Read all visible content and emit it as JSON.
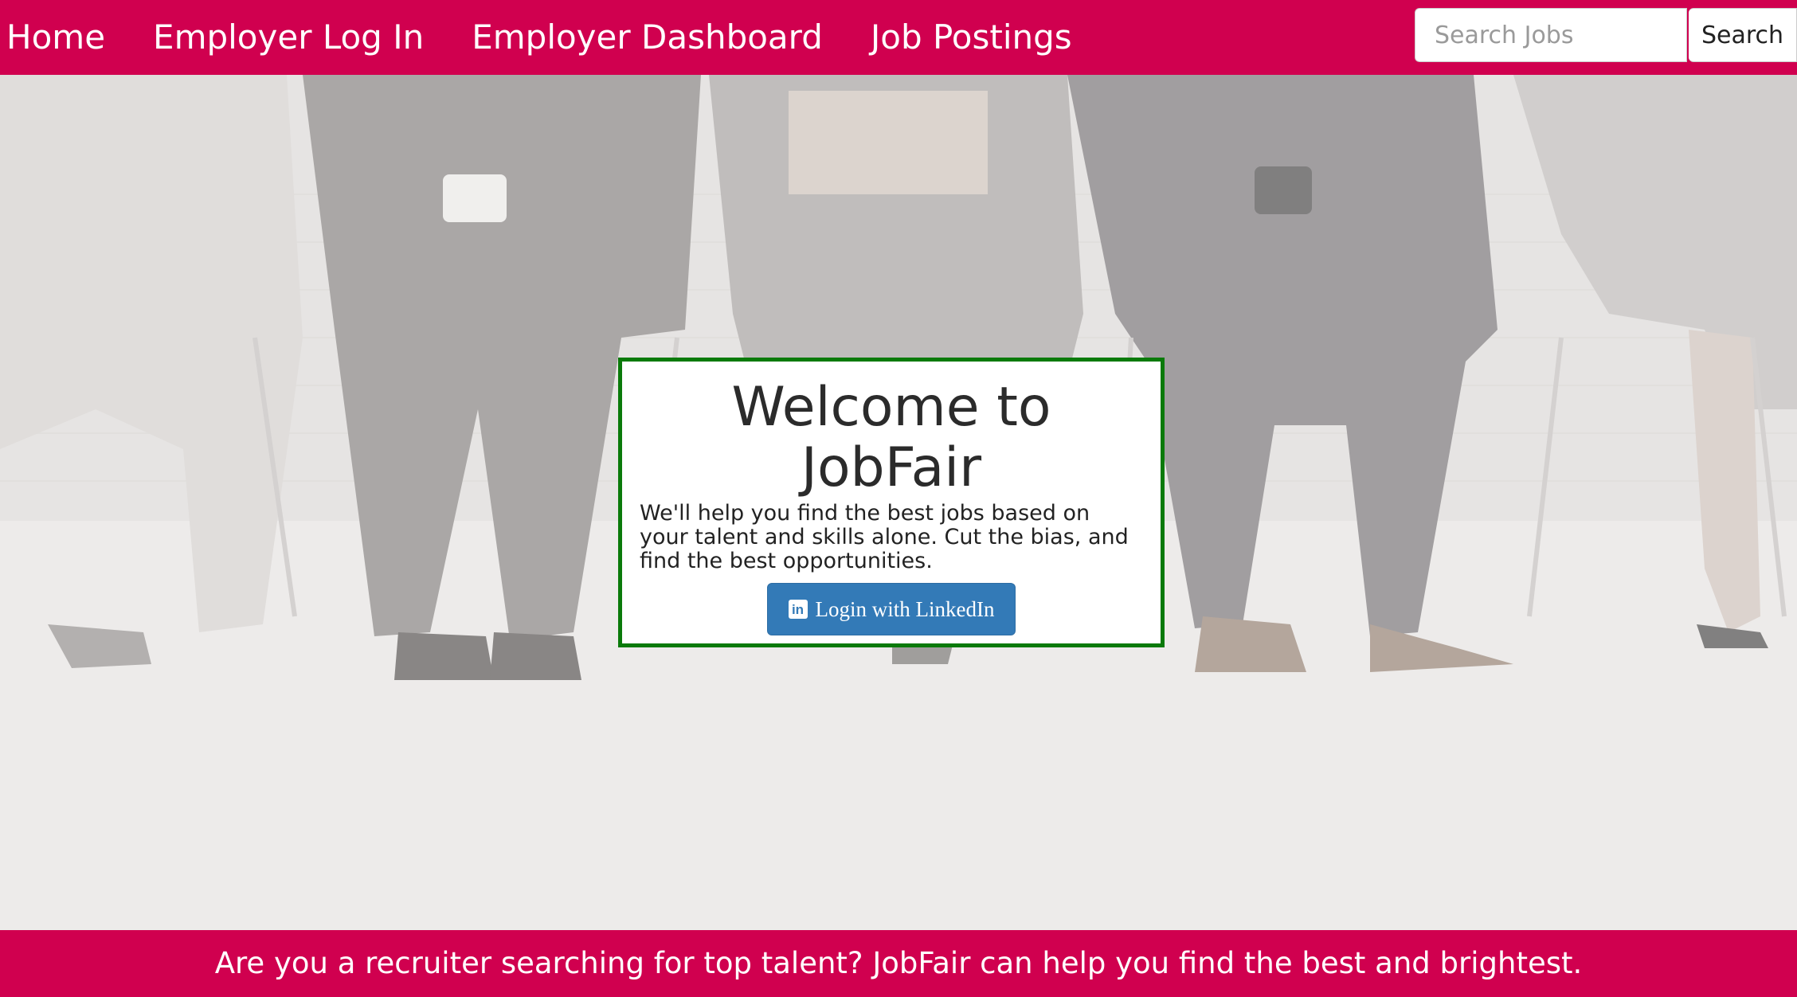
{
  "nav": {
    "items": [
      {
        "label": "Home"
      },
      {
        "label": "Employer Log In"
      },
      {
        "label": "Employer Dashboard"
      },
      {
        "label": "Job Postings"
      }
    ]
  },
  "search": {
    "placeholder": "Search Jobs",
    "value": "",
    "button_label": "Search"
  },
  "welcome": {
    "title": "Welcome to JobFair",
    "text": "We'll help you find the best jobs based on your talent and skills alone. Cut the bias, and find the best opportunities.",
    "login_label": "Login with LinkedIn",
    "icon": "linkedin-icon"
  },
  "footer": {
    "text": "Are you a recruiter searching for top talent? JobFair can help you find the best and brightest."
  },
  "colors": {
    "brand": "#d0004f",
    "card_border": "#0a7a0a",
    "linkedin_button": "#337ab7"
  }
}
